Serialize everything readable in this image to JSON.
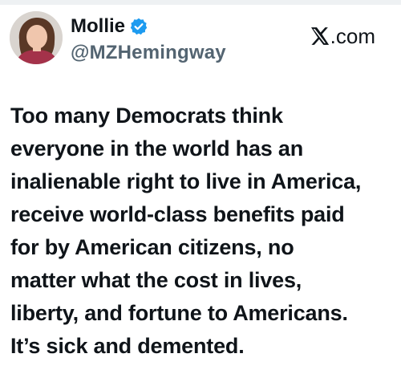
{
  "post": {
    "author": {
      "display_name": "Mollie",
      "handle": "@MZHemingway",
      "verified": true,
      "avatar_icon": "profile-photo"
    },
    "brand": {
      "icon": "x-logo-icon",
      "label": ".com"
    },
    "text": "Too many Democrats think\neveryone in the world has an\ninalienable right to live in America,\nreceive world-class benefits paid\nfor by American citizens, no\nmatter what the cost in lives,\nliberty, and fortune to Americans.\nIt’s sick and demented."
  },
  "colors": {
    "text": "#0f1419",
    "handle": "#536471",
    "verified_badge": "#1d9bf0",
    "background": "#ffffff"
  }
}
